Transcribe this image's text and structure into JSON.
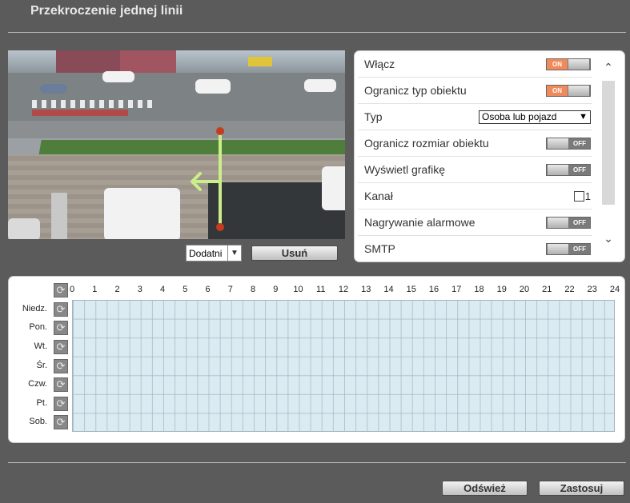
{
  "page": {
    "title": "Przekroczenie jednej linii"
  },
  "direction": {
    "selected": "Dodatni",
    "delete_label": "Usuń"
  },
  "settings": {
    "rows": [
      {
        "label": "Włącz",
        "control": "toggle",
        "state": "ON"
      },
      {
        "label": "Ogranicz typ obiektu",
        "control": "toggle",
        "state": "ON"
      },
      {
        "label": "Typ",
        "control": "select",
        "value": "Osoba lub pojazd"
      },
      {
        "label": "Ogranicz rozmiar obiektu",
        "control": "toggle",
        "state": "OFF"
      },
      {
        "label": "Wyświetl grafikę",
        "control": "toggle",
        "state": "OFF"
      },
      {
        "label": "Kanał",
        "control": "checkbox",
        "value": "1"
      },
      {
        "label": "Nagrywanie alarmowe",
        "control": "toggle",
        "state": "OFF"
      },
      {
        "label": "SMTP",
        "control": "toggle",
        "state": "OFF"
      }
    ]
  },
  "schedule": {
    "hours": [
      "0",
      "1",
      "2",
      "3",
      "4",
      "5",
      "6",
      "7",
      "8",
      "9",
      "10",
      "11",
      "12",
      "13",
      "14",
      "15",
      "16",
      "17",
      "18",
      "19",
      "20",
      "21",
      "22",
      "23",
      "24"
    ],
    "days": [
      "Niedz.",
      "Pon.",
      "Wt.",
      "Śr.",
      "Czw.",
      "Pt.",
      "Sob."
    ]
  },
  "footer": {
    "refresh_label": "Odśwież",
    "apply_label": "Zastosuj"
  },
  "colors": {
    "toggle_on": "#f08a5b",
    "toggle_off": "#7a7a7a",
    "grid": "#dbebf2",
    "line": "#ccee88",
    "endpoint": "#c53b1f"
  }
}
